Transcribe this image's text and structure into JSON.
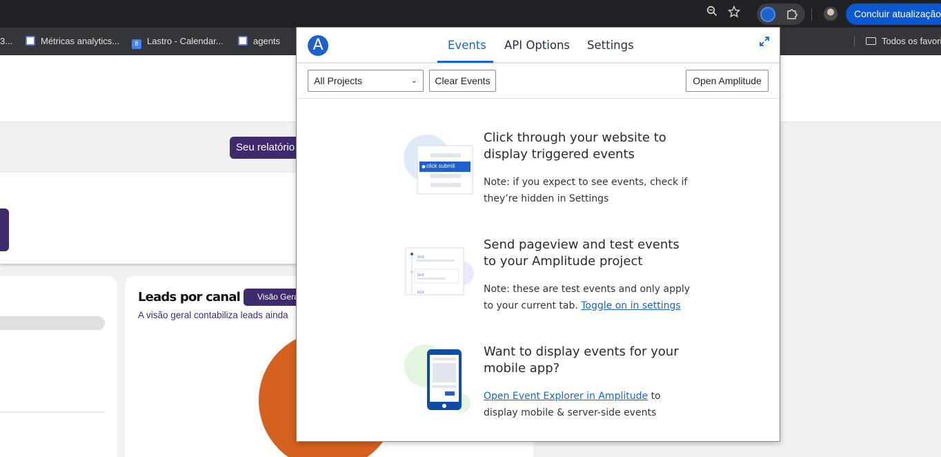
{
  "browser": {
    "update_button": "Concluir atualização",
    "bookmarks": [
      {
        "label": "3..."
      },
      {
        "label": "Métricas analytics..."
      },
      {
        "label": "Lastro - Calendar..."
      },
      {
        "label": "agents"
      }
    ],
    "bookmarks_folder": "Todos os favoritos",
    "calendar_icon_text": "8"
  },
  "page": {
    "report_pill": "Seu relatório",
    "leads_title": "Leads por canal",
    "visao_button": "Visão Geral",
    "leads_subtitle": "A visão geral contabiliza leads ainda"
  },
  "popup": {
    "tabs": [
      {
        "label": "Events",
        "active": true
      },
      {
        "label": "API Options",
        "active": false
      },
      {
        "label": "Settings",
        "active": false
      }
    ],
    "project_select": {
      "value": "All Projects"
    },
    "clear_button": "Clear Events",
    "open_button": "Open Amplitude",
    "sections": [
      {
        "title_line1": "Click through your website to",
        "title_line2": "display triggered events",
        "note_line1": "Note: if you expect to see events, check if",
        "note_line2": "they’re hidden in Settings",
        "illus_button": "click submit"
      },
      {
        "title_line1": "Send pageview and test events",
        "title_line2": "to your Amplitude project",
        "note_line1": "Note: these are test events and only apply",
        "note_line2_prefix": "to your current tab.",
        "note_link": "Toggle on in settings",
        "illus_labels": [
          "test",
          "test",
          "test"
        ]
      },
      {
        "title_line1": "Want to display events for your",
        "title_line2": "mobile app?",
        "note_link": "Open Event Explorer in Amplitude",
        "note_line1_suffix": "to",
        "note_line2": "display mobile & server-side events"
      }
    ]
  },
  "colors": {
    "amplitude_blue": "#1664d1",
    "purple": "#3f2a6e",
    "pie_orange": "#d4611d"
  }
}
